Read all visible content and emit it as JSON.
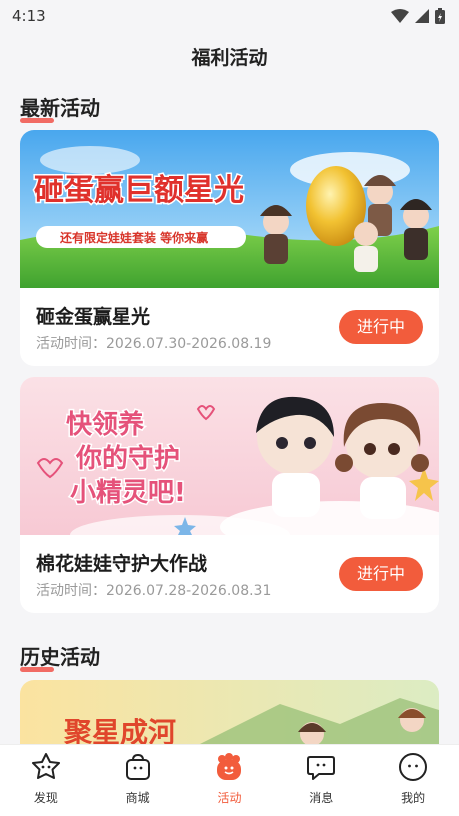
{
  "status_bar": {
    "time": "4:13"
  },
  "header": {
    "title": "福利活动"
  },
  "sections": {
    "latest": "最新活动",
    "history": "历史活动"
  },
  "cards": [
    {
      "banner_title": "砸蛋赢巨额星光",
      "banner_subtitle": "还有限定娃娃套装 等你来赢",
      "name": "砸金蛋赢星光",
      "time": "活动时间：2026.07.30-2026.08.19",
      "status": "进行中"
    },
    {
      "banner_line1": "快领养",
      "banner_line2": "你的守护",
      "banner_line3": "小精灵吧!",
      "name": "棉花娃娃守护大作战",
      "time": "活动时间：2026.07.28-2026.08.31",
      "status": "进行中"
    },
    {
      "banner_title": "聚星成河"
    }
  ],
  "bottom_nav": [
    {
      "label": "发现",
      "icon": "star-face-icon",
      "active": false
    },
    {
      "label": "商城",
      "icon": "bag-face-icon",
      "active": false
    },
    {
      "label": "活动",
      "icon": "paw-face-icon",
      "active": true
    },
    {
      "label": "消息",
      "icon": "chat-bubble-icon",
      "active": false
    },
    {
      "label": "我的",
      "icon": "profile-face-icon",
      "active": false
    }
  ],
  "colors": {
    "accent": "#f25c3c",
    "background": "#f5f5f7"
  }
}
